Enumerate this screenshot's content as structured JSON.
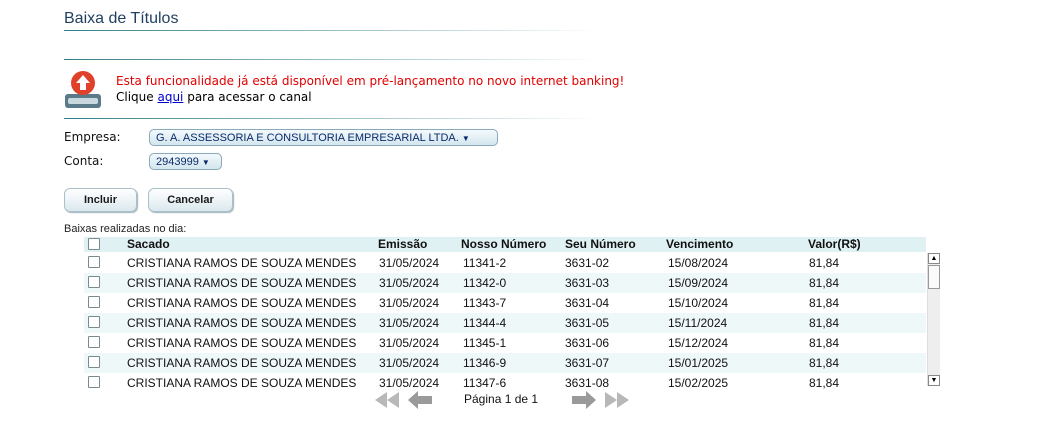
{
  "page": {
    "title": "Baixa de Títulos"
  },
  "notice": {
    "message": "Esta funcionalidade já está disponível em pré-lançamento no novo internet banking!",
    "line2_before": "Clique ",
    "link_text": "aqui",
    "line2_after": " para acessar o canal"
  },
  "form": {
    "empresa_label": "Empresa:",
    "empresa_value": "G. A. ASSESSORIA E CONSULTORIA EMPRESARIAL LTDA.",
    "conta_label": "Conta:",
    "conta_value": "2943999"
  },
  "buttons": {
    "incluir": "Incluir",
    "cancelar": "Cancelar"
  },
  "table": {
    "section_label": "Baixas realizadas no dia:",
    "headers": {
      "sacado": "Sacado",
      "emissao": "Emissão",
      "nosso_numero": "Nosso Número",
      "seu_numero": "Seu Número",
      "vencimento": "Vencimento",
      "valor": "Valor(R$)"
    },
    "rows": [
      {
        "sacado": "CRISTIANA  RAMOS DE SOUZA MENDES",
        "emissao": "31/05/2024",
        "nosso_numero": "11341-2",
        "seu_numero": "3631-02",
        "vencimento": "15/08/2024",
        "valor": "81,84"
      },
      {
        "sacado": "CRISTIANA  RAMOS DE SOUZA MENDES",
        "emissao": "31/05/2024",
        "nosso_numero": "11342-0",
        "seu_numero": "3631-03",
        "vencimento": "15/09/2024",
        "valor": "81,84"
      },
      {
        "sacado": "CRISTIANA  RAMOS DE SOUZA MENDES",
        "emissao": "31/05/2024",
        "nosso_numero": "11343-7",
        "seu_numero": "3631-04",
        "vencimento": "15/10/2024",
        "valor": "81,84"
      },
      {
        "sacado": "CRISTIANA  RAMOS DE SOUZA MENDES",
        "emissao": "31/05/2024",
        "nosso_numero": "11344-4",
        "seu_numero": "3631-05",
        "vencimento": "15/11/2024",
        "valor": "81,84"
      },
      {
        "sacado": "CRISTIANA  RAMOS DE SOUZA MENDES",
        "emissao": "31/05/2024",
        "nosso_numero": "11345-1",
        "seu_numero": "3631-06",
        "vencimento": "15/12/2024",
        "valor": "81,84"
      },
      {
        "sacado": "CRISTIANA  RAMOS DE SOUZA MENDES",
        "emissao": "31/05/2024",
        "nosso_numero": "11346-9",
        "seu_numero": "3631-07",
        "vencimento": "15/01/2025",
        "valor": "81,84"
      },
      {
        "sacado": "CRISTIANA  RAMOS DE SOUZA MENDES",
        "emissao": "31/05/2024",
        "nosso_numero": "11347-6",
        "seu_numero": "3631-08",
        "vencimento": "15/02/2025",
        "valor": "81,84"
      }
    ]
  },
  "pager": {
    "text": "Página 1 de 1"
  },
  "icons": {
    "notice": "upload-alert-icon",
    "first": "first-page-icon",
    "prev": "prev-page-icon",
    "next": "next-page-icon",
    "last": "last-page-icon"
  },
  "colors": {
    "accent": "#2f7f88",
    "alert": "#e00000",
    "header_bg": "#e0f1f4",
    "link": "#0000cc"
  }
}
